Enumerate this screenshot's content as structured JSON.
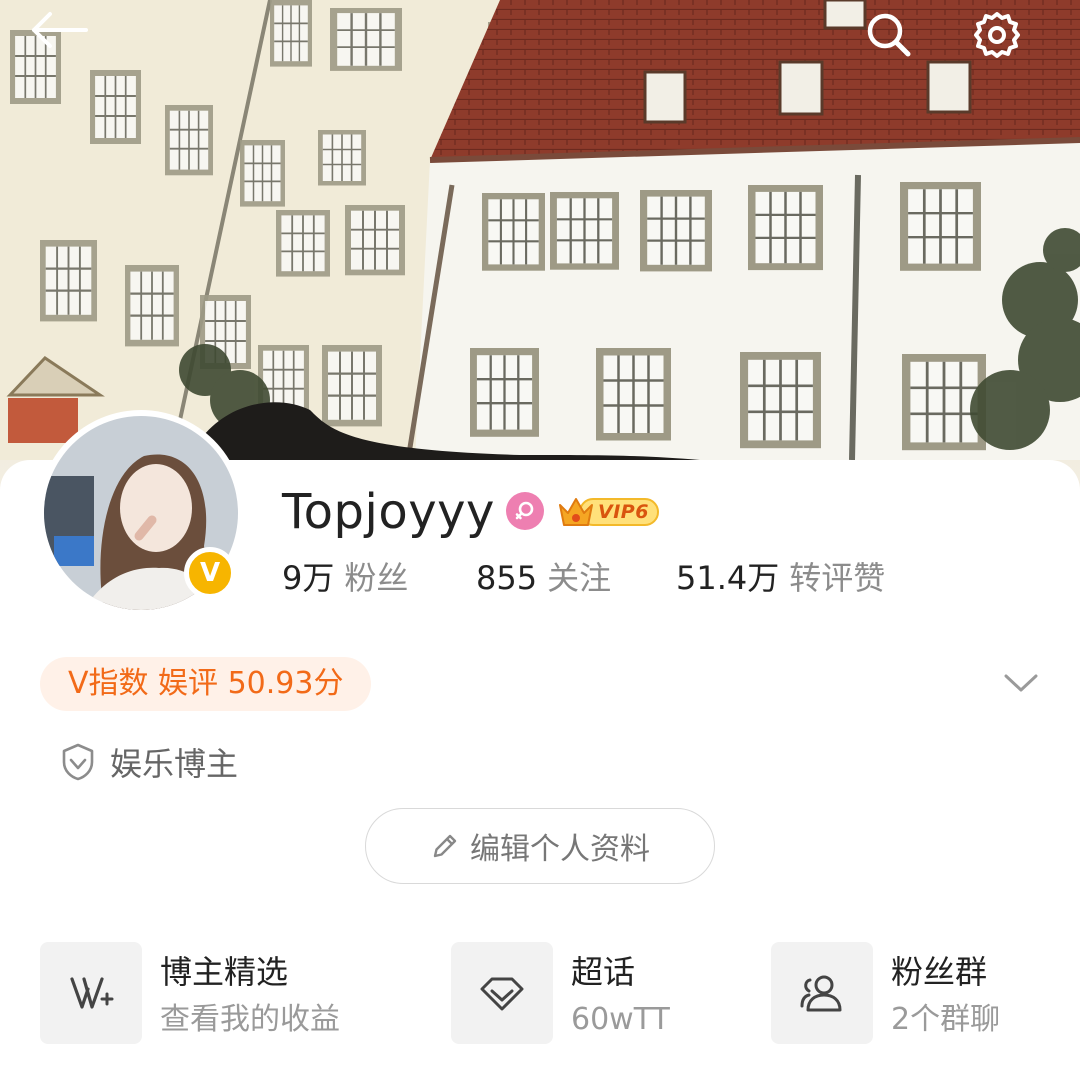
{
  "header": {
    "back_icon": "back-arrow-icon",
    "search_icon": "search-icon",
    "settings_icon": "gear-icon"
  },
  "profile": {
    "username": "Topjoyyy",
    "gender_icon": "female-icon",
    "vip_label": "VIP6",
    "verified_badge": "V",
    "stats": [
      {
        "value": "9万",
        "label": "粉丝"
      },
      {
        "value": "855",
        "label": "关注"
      },
      {
        "value": "51.4万",
        "label": "转评赞"
      }
    ],
    "v_index": "V指数 娱评 50.93分",
    "identity": "娱乐博主",
    "edit_button": "编辑个人资料"
  },
  "entries": [
    {
      "title": "博主精选",
      "subtitle": "查看我的收益",
      "icon": "v-plus-icon"
    },
    {
      "title": "超话",
      "subtitle": "60wTT",
      "icon": "diamond-icon"
    },
    {
      "title": "粉丝群",
      "subtitle": "2个群聊",
      "icon": "group-icon"
    }
  ],
  "colors": {
    "accent_orange": "#f26a18",
    "v_index_bg": "#fff1e8",
    "verified_yellow": "#f7b500",
    "gender_pink": "#ee7fb1"
  }
}
